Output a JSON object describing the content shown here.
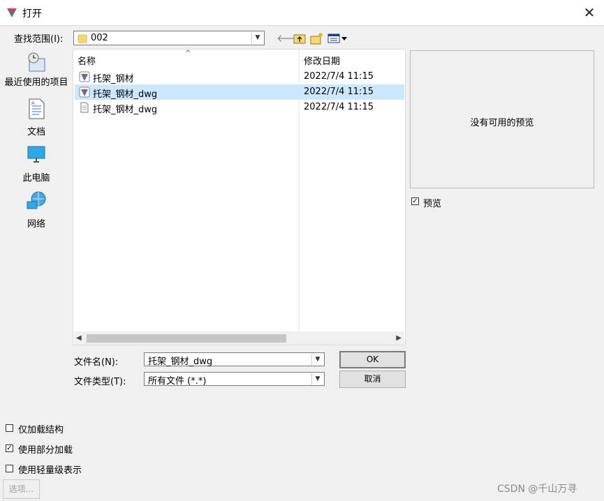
{
  "window": {
    "title": "打开",
    "close_glyph": "✕"
  },
  "lookin": {
    "label": "查找范围(I):",
    "value": "002"
  },
  "places": [
    {
      "label": "最近使用的项目",
      "icon": "recent-places-icon"
    },
    {
      "label": "文档",
      "icon": "documents-icon"
    },
    {
      "label": "此电脑",
      "icon": "this-pc-icon"
    },
    {
      "label": "网络",
      "icon": "network-icon"
    }
  ],
  "list": {
    "col_name": "名称",
    "col_date": "修改日期",
    "rows": [
      {
        "name": "托架_钢材",
        "date": "2022/7/4 11:15",
        "icon": "app-file-icon",
        "selected": false
      },
      {
        "name": "托架_钢材_dwg",
        "date": "2022/7/4 11:15",
        "icon": "app-file-icon",
        "selected": true
      },
      {
        "name": "托架_钢材_dwg",
        "date": "2022/7/4 11:15",
        "icon": "text-file-icon",
        "selected": false
      }
    ]
  },
  "preview": {
    "message": "没有可用的预览",
    "checkbox_label": "预览",
    "checked": true
  },
  "filename": {
    "label": "文件名(N):",
    "value": "托架_钢材_dwg"
  },
  "filetype": {
    "label": "文件类型(T):",
    "value": "所有文件 (*.*)"
  },
  "buttons": {
    "ok": "OK",
    "cancel": "取消",
    "options": "选项..."
  },
  "options": [
    {
      "label": "仅加载结构",
      "checked": false
    },
    {
      "label": "使用部分加载",
      "checked": true
    },
    {
      "label": "使用轻量级表示",
      "checked": false
    }
  ],
  "watermark": "CSDN @千山万寻",
  "colors": {
    "selection": "#cce8ff",
    "folder": "#f7d774"
  }
}
